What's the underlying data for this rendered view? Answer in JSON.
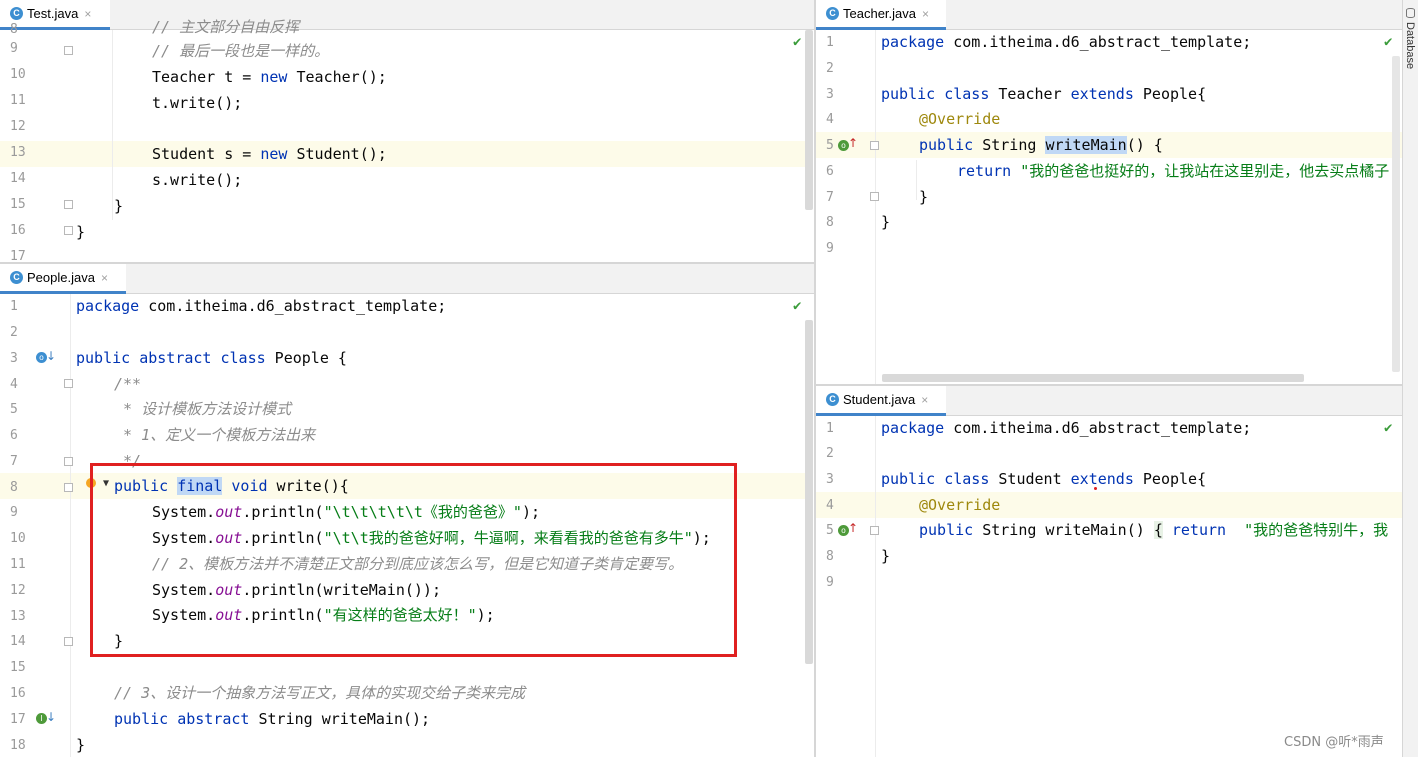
{
  "tabs": {
    "test": {
      "label": "Test.java",
      "close": "×"
    },
    "people": {
      "label": "People.java",
      "close": "×"
    },
    "teacher": {
      "label": "Teacher.java",
      "close": "×"
    },
    "student": {
      "label": "Student.java",
      "close": "×"
    }
  },
  "sidebar": {
    "database_label": "Database"
  },
  "watermark": "CSDN @听*雨声",
  "test_code": {
    "line_numbers": [
      "8",
      "9",
      "10",
      "11",
      "12",
      "13",
      "14",
      "15",
      "16",
      "17"
    ],
    "lines": {
      "l8": "// 主文部分自由反挥",
      "l9": "// 最后一段也是一样的。",
      "l10a": "Teacher t = ",
      "l10b": "new",
      "l10c": " Teacher();",
      "l11": "t.write();",
      "l13a": "Student s = ",
      "l13b": "new",
      "l13c": " Student();",
      "l14": "s.write();",
      "l15": "}",
      "l16": "}"
    }
  },
  "people_code": {
    "line_numbers": [
      "1",
      "2",
      "3",
      "4",
      "5",
      "6",
      "7",
      "8",
      "9",
      "10",
      "11",
      "12",
      "13",
      "14",
      "15",
      "16",
      "17",
      "18"
    ],
    "lines": {
      "l1a": "package",
      "l1b": " com.itheima.d6_abstract_template;",
      "l3a": "public abstract class",
      "l3b": " People {",
      "l4": "/**",
      "l5": " * 设计模板方法设计模式",
      "l6": " * 1、定义一个模板方法出来",
      "l7": " */",
      "l8a": "public",
      "l8b": "final",
      "l8c": "void",
      "l8d": " write(){",
      "l9a": "System.",
      "l9b": "out",
      "l9c": ".println(",
      "l9d": "\"\\t\\t\\t\\t\\t《我的爸爸》\"",
      "l9e": ");",
      "l10a": "System.",
      "l10b": "out",
      "l10c": ".println(",
      "l10d": "\"\\t\\t我的爸爸好啊，牛逼啊，来看看我的爸爸有多牛\"",
      "l10e": ");",
      "l11": "// 2、模板方法并不清楚正文部分到底应该怎么写，但是它知道子类肯定要写。",
      "l12a": "System.",
      "l12b": "out",
      "l12c": ".println(writeMain());",
      "l13a": "System.",
      "l13b": "out",
      "l13c": ".println(",
      "l13d": "\"有这样的爸爸太好！\"",
      "l13e": ");",
      "l14": "}",
      "l16": "// 3、设计一个抽象方法写正文，具体的实现交给子类来完成",
      "l17a": "public abstract",
      "l17b": " String writeMain();",
      "l18": "}"
    }
  },
  "teacher_code": {
    "line_numbers": [
      "1",
      "2",
      "3",
      "4",
      "5",
      "6",
      "7",
      "8",
      "9"
    ],
    "lines": {
      "l1a": "package",
      "l1b": " com.itheima.d6_abstract_template;",
      "l3a": "public class",
      "l3b": " Teacher ",
      "l3c": "extends",
      "l3d": " People{",
      "l4": "@Override",
      "l5a": "public",
      "l5b": " String ",
      "l5c": "writeMain",
      "l5d": "() {",
      "l6a": "return",
      "l6b": " \"我的爸爸也挺好的，让我站在这里别走，他去买点橘子",
      "l7": "}",
      "l8": "}"
    }
  },
  "student_code": {
    "line_numbers": [
      "1",
      "2",
      "3",
      "4",
      "5",
      "8",
      "9"
    ],
    "lines": {
      "l1a": "package",
      "l1b": " com.itheima.d6_abstract_template;",
      "l3a": "public class",
      "l3b": " Student ",
      "l3c": "extends",
      "l3d": " People{",
      "l4": "@Override",
      "l5a": "public",
      "l5b": " String writeMain() ",
      "l5c": "{",
      "l5d": "return",
      "l5e": "  \"我的爸爸特别牛，我",
      "l8": "}"
    }
  },
  "colors": {
    "highlight_box": "#e02020",
    "keyword": "#0033b3",
    "string": "#067d17",
    "comment": "#8c8c8c",
    "annotation": "#9e880d",
    "field": "#871094"
  }
}
